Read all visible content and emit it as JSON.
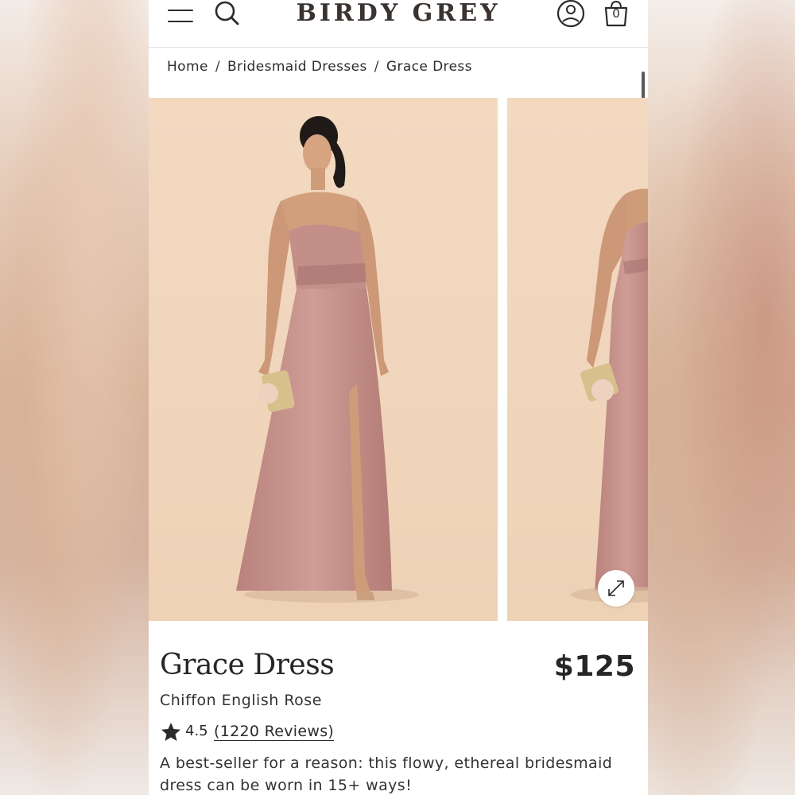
{
  "header": {
    "logo": "BIRDY GREY",
    "cart_count": "0",
    "icons": [
      "menu-icon",
      "search-icon",
      "account-icon",
      "cart-icon"
    ]
  },
  "breadcrumb": {
    "items": [
      "Home",
      "Bridesmaid Dresses",
      "Grace Dress"
    ],
    "separator": "/"
  },
  "gallery": {
    "images": [
      {
        "alt": "model-front-view"
      },
      {
        "alt": "model-side-view"
      }
    ],
    "expand_icon": "expand-arrows-icon"
  },
  "product": {
    "title": "Grace Dress",
    "price": "$125",
    "color": "Chiffon English Rose",
    "rating": "4.5",
    "reviews_label": "(1220 Reviews)",
    "description": "A best-seller for a reason: this flowy, ethereal bridesmaid dress can be worn in 15+ ways!"
  },
  "colors": {
    "text": "#262626",
    "photo_background": "#f0d6bc",
    "dress": "#c9948f",
    "border": "#e3e3e3"
  }
}
